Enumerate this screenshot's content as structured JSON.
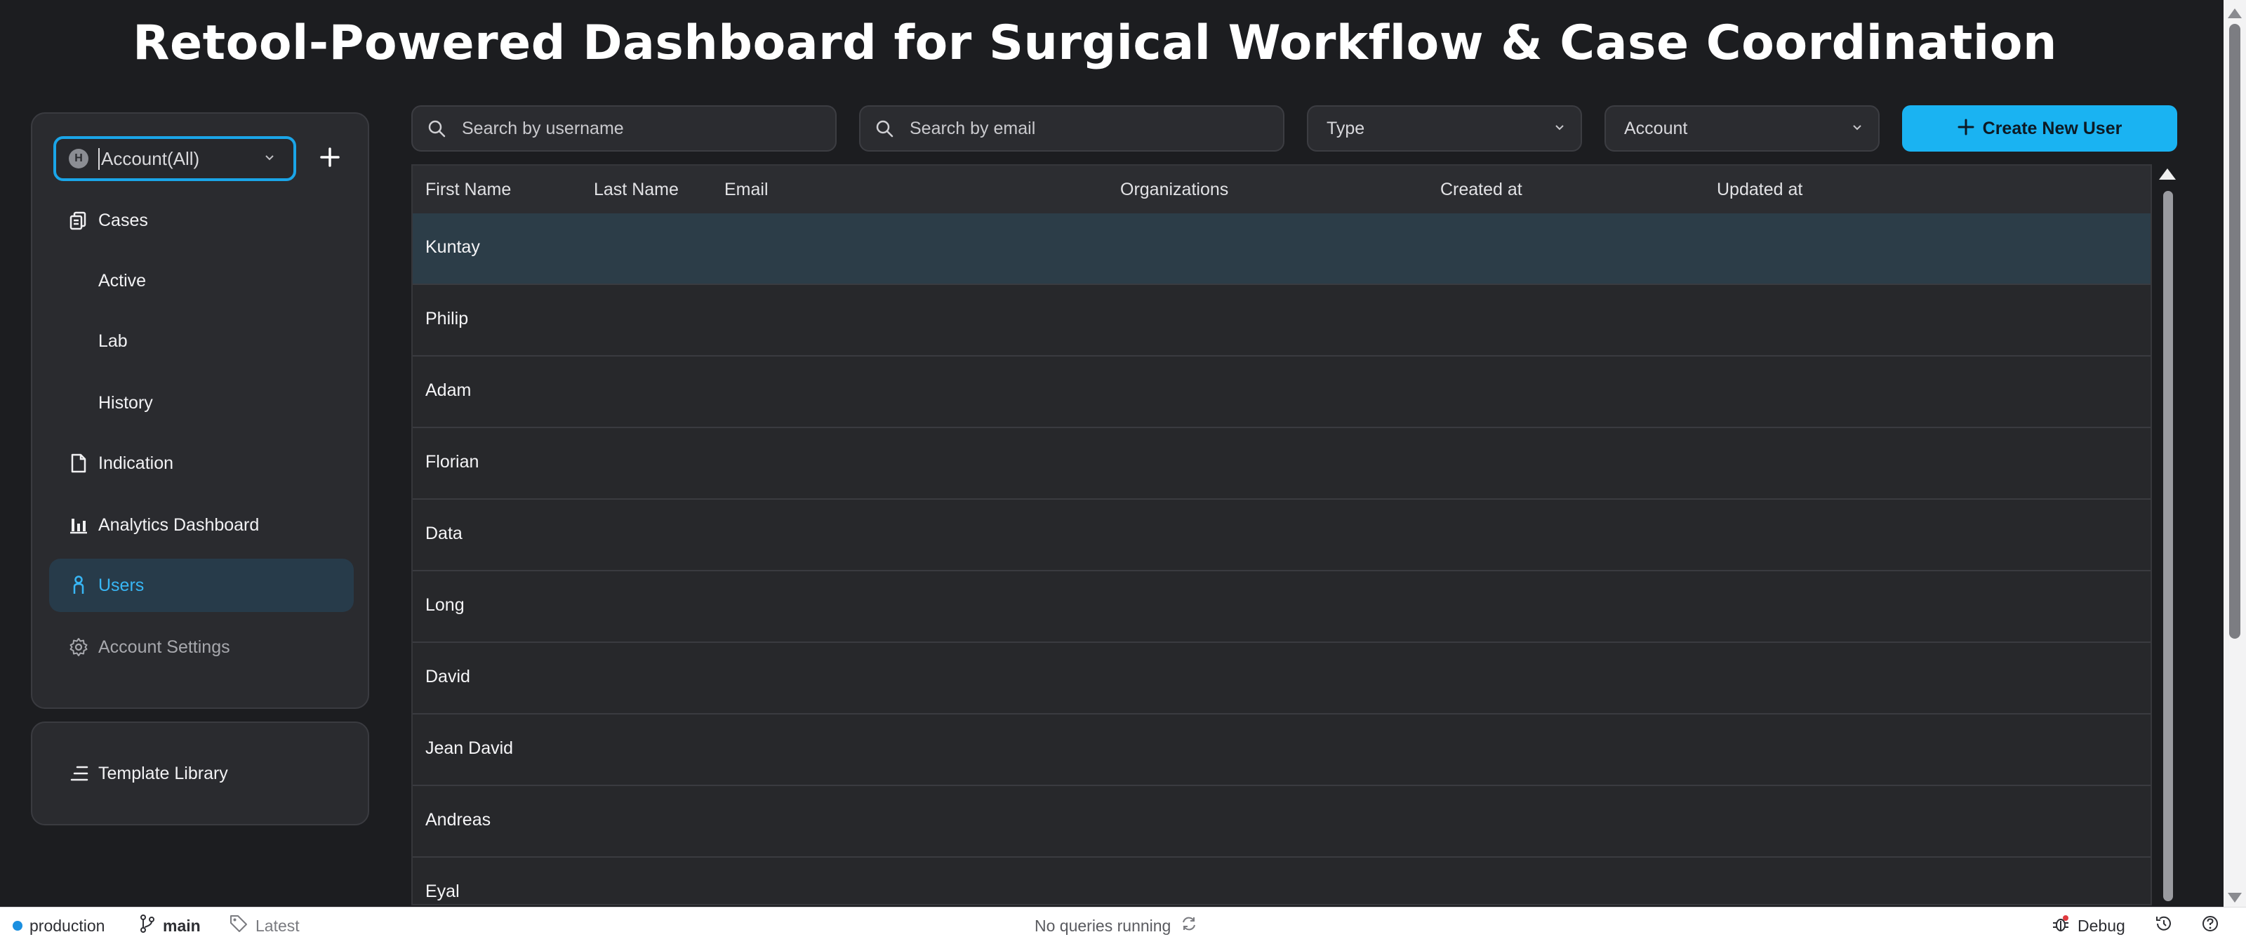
{
  "app": {
    "title": "Retool-Powered Dashboard for Surgical Workflow & Case Coordination",
    "accent_color": "#1ab3f2"
  },
  "sidebar": {
    "account_select": {
      "badge": "H",
      "value": "Account(All)"
    },
    "items": [
      {
        "label": "Cases",
        "icon": "cases-icon"
      },
      {
        "label": "Active"
      },
      {
        "label": "Lab"
      },
      {
        "label": "History"
      },
      {
        "label": "Indication",
        "icon": "document-icon"
      },
      {
        "label": "Analytics Dashboard",
        "icon": "bar-chart-icon"
      },
      {
        "label": "Users",
        "icon": "user-icon",
        "active": true
      },
      {
        "label": "Account Settings",
        "icon": "gear-icon"
      }
    ],
    "library": {
      "label": "Template Library",
      "icon": "list-icon"
    }
  },
  "toolbar": {
    "search_username_placeholder": "Search by username",
    "search_email_placeholder": "Search by email",
    "type_label": "Type",
    "account_label": "Account",
    "create_label": "Create New User"
  },
  "table": {
    "columns": [
      "First Name",
      "Last Name",
      "Email",
      "Organizations",
      "Created at",
      "Updated at"
    ],
    "rows": [
      {
        "first_name": "Kuntay",
        "selected": true
      },
      {
        "first_name": "Philip"
      },
      {
        "first_name": "Adam"
      },
      {
        "first_name": "Florian"
      },
      {
        "first_name": "Data"
      },
      {
        "first_name": "Long"
      },
      {
        "first_name": "David"
      },
      {
        "first_name": "Jean David"
      },
      {
        "first_name": "Andreas"
      },
      {
        "first_name": "Eyal"
      }
    ]
  },
  "footer": {
    "environment": "production",
    "branch": "main",
    "version": "Latest",
    "query_status": "No queries running",
    "debug_label": "Debug"
  }
}
